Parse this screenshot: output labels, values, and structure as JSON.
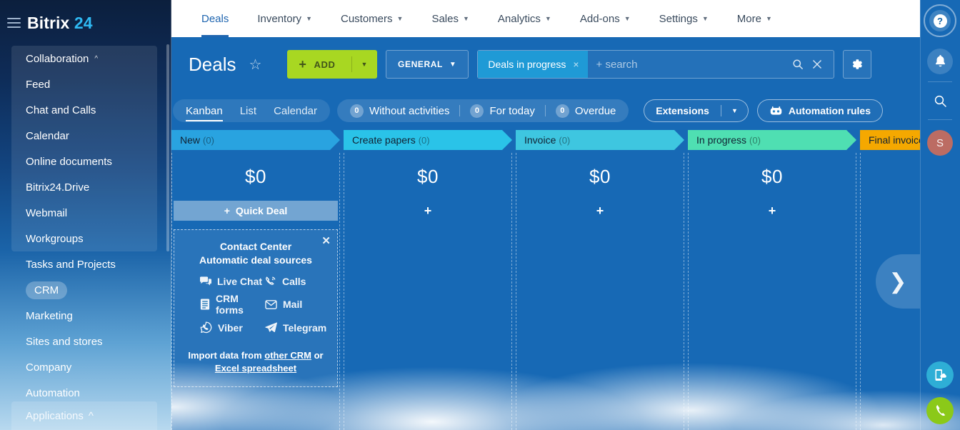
{
  "brand": {
    "name": "Bitrix",
    "number": "24",
    "hamburger_icon": "hamburger-icon"
  },
  "sidebar": {
    "group": {
      "label": "Collaboration",
      "caret": "⌃",
      "items": [
        {
          "label": "Feed"
        },
        {
          "label": "Chat and Calls"
        },
        {
          "label": "Calendar"
        },
        {
          "label": "Online documents"
        },
        {
          "label": "Bitrix24.Drive"
        },
        {
          "label": "Webmail"
        },
        {
          "label": "Workgroups"
        }
      ]
    },
    "items": [
      {
        "label": "Tasks and Projects",
        "active": false
      },
      {
        "label": "CRM",
        "active": true
      },
      {
        "label": "Marketing",
        "active": false
      },
      {
        "label": "Sites and stores",
        "active": false
      },
      {
        "label": "Company",
        "active": false
      },
      {
        "label": "Automation",
        "active": false
      }
    ],
    "applications": {
      "label": "Applications",
      "caret": "⌃"
    }
  },
  "topnav": {
    "items": [
      {
        "label": "Deals",
        "active": true,
        "has_chevron": false
      },
      {
        "label": "Inventory",
        "active": false,
        "has_chevron": true
      },
      {
        "label": "Customers",
        "active": false,
        "has_chevron": true
      },
      {
        "label": "Sales",
        "active": false,
        "has_chevron": true
      },
      {
        "label": "Analytics",
        "active": false,
        "has_chevron": true
      },
      {
        "label": "Add-ons",
        "active": false,
        "has_chevron": true
      },
      {
        "label": "Settings",
        "active": false,
        "has_chevron": true
      },
      {
        "label": "More",
        "active": false,
        "has_chevron": true
      }
    ]
  },
  "toolbar": {
    "title": "Deals",
    "star_icon": "star-icon",
    "add_label": "ADD",
    "add_plus": "+",
    "add_dropdown_icon": "chevron-down-icon",
    "general_label": "GENERAL",
    "general_chevron": "⌄",
    "filter_chip": "Deals in progress",
    "chip_close": "×",
    "search_placeholder": "+ search",
    "search_icon": "search-icon",
    "clear_icon": "close-icon",
    "gear_icon": "gear-icon"
  },
  "subbar": {
    "views": [
      {
        "label": "Kanban",
        "active": true
      },
      {
        "label": "List",
        "active": false
      },
      {
        "label": "Calendar",
        "active": false
      }
    ],
    "counters": [
      {
        "count": "0",
        "label": "Without activities"
      },
      {
        "count": "0",
        "label": "For today"
      },
      {
        "count": "0",
        "label": "Overdue"
      }
    ],
    "extensions_label": "Extensions",
    "extensions_arrow": "chevron-down-icon",
    "automation_label": "Automation rules",
    "automation_icon": "robot-icon"
  },
  "kanban": {
    "quick_deal_label": "Quick Deal",
    "quick_deal_plus": "+",
    "add_plus": "+",
    "columns": [
      {
        "name": "New",
        "count": "(0)",
        "sum": "$0",
        "color": "#29a3e0"
      },
      {
        "name": "Create papers",
        "count": "(0)",
        "sum": "$0",
        "color": "#2ac3e8"
      },
      {
        "name": "Invoice",
        "count": "(0)",
        "sum": "$0",
        "color": "#3ec6e0"
      },
      {
        "name": "In progress",
        "count": "(0)",
        "sum": "$0",
        "color": "#4fdfb2"
      },
      {
        "name": "Final invoice",
        "count": "",
        "sum": "",
        "color": "#f5a800"
      }
    ],
    "scroll_next_icon": "chevron-right-icon"
  },
  "promo": {
    "close_icon": "close-icon",
    "title": "Contact Center",
    "subtitle": "Automatic deal sources",
    "sources": [
      {
        "label": "Live Chat",
        "icon": "chat-bubbles-icon"
      },
      {
        "label": "Calls",
        "icon": "phone-icon"
      },
      {
        "label": "CRM forms",
        "icon": "form-icon"
      },
      {
        "label": "Mail",
        "icon": "envelope-icon"
      },
      {
        "label": "Viber",
        "icon": "viber-icon"
      },
      {
        "label": "Telegram",
        "icon": "telegram-icon"
      }
    ],
    "footer_prefix": "Import data from ",
    "footer_link1": "other CRM",
    "footer_middle": " or ",
    "footer_link2": "Excel spreadsheet"
  },
  "rail": {
    "help_icon": "help-icon",
    "help_glyph": "?",
    "bell_icon": "bell-icon",
    "search_icon": "search-icon",
    "avatar_initial": "S",
    "mobile_app_icon": "mobile-cloud-icon",
    "call_icon": "phone-icon"
  },
  "colors": {
    "accent_blue": "#2066b0",
    "add_green": "#a8d722",
    "chip_blue": "#1f9ad6",
    "avatar": "#bc6c63",
    "fab_cyan": "#2eaed6",
    "fab_green": "#8bc919"
  }
}
